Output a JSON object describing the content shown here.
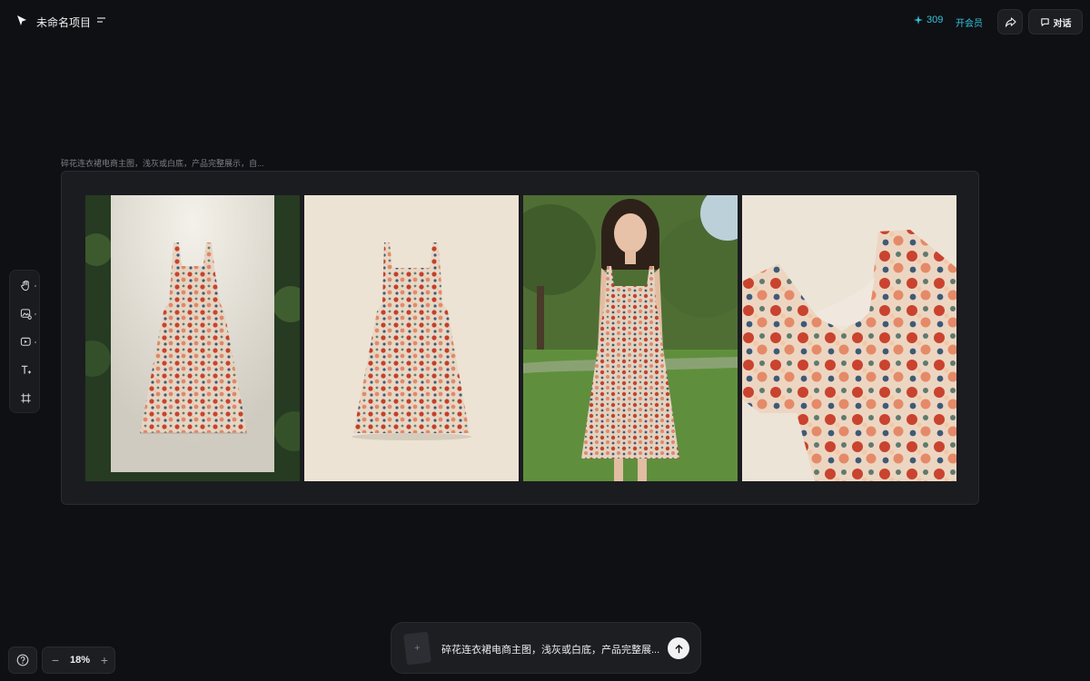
{
  "header": {
    "project_title": "未命名项目",
    "credits": "309",
    "vip_label": "开会员",
    "chat_label": "对话"
  },
  "toolbar": {
    "tools": [
      {
        "icon": "hand-icon"
      },
      {
        "icon": "image-generate-icon"
      },
      {
        "icon": "video-generate-icon"
      },
      {
        "icon": "text-icon"
      },
      {
        "icon": "frame-icon"
      }
    ]
  },
  "canvas": {
    "group_caption": "碎花连衣裙电商主图，浅灰或白底，产品完整展示，自...",
    "images": [
      {
        "label": "dress-flatlay-garden"
      },
      {
        "label": "dress-flatlay-plain"
      },
      {
        "label": "model-in-park"
      },
      {
        "label": "dress-closeup"
      }
    ]
  },
  "zoom": {
    "value": "18%"
  },
  "prompt": {
    "text": "碎花连衣裙电商主图，浅灰或白底，产品完整展...",
    "attach_symbol": "+"
  },
  "colors": {
    "background": "#0f1013",
    "panel": "#1d1e22",
    "accent": "#34c4e0"
  }
}
